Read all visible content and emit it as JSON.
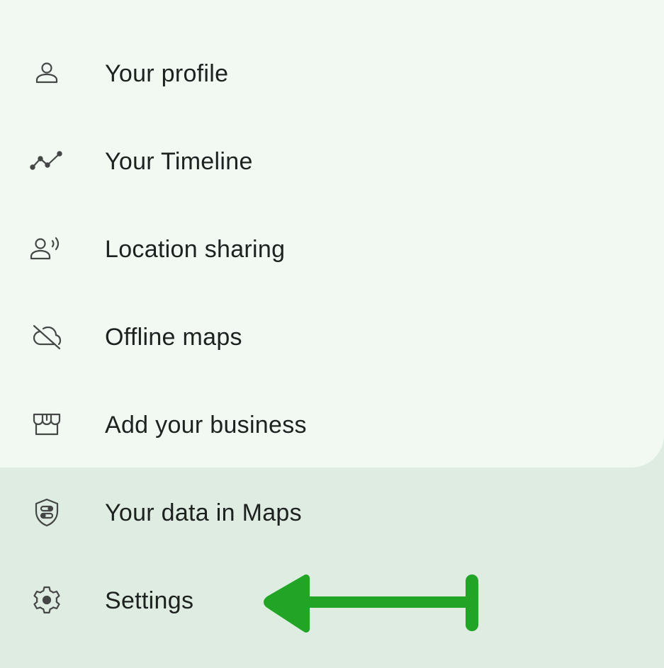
{
  "menu": {
    "items": [
      {
        "label": "Your profile",
        "icon": "person-icon"
      },
      {
        "label": "Your Timeline",
        "icon": "timeline-icon"
      },
      {
        "label": "Location sharing",
        "icon": "location-sharing-icon"
      },
      {
        "label": "Offline maps",
        "icon": "cloud-off-icon"
      },
      {
        "label": "Add your business",
        "icon": "storefront-icon"
      },
      {
        "label": "Your data in Maps",
        "icon": "shield-icon"
      },
      {
        "label": "Settings",
        "icon": "gear-icon"
      }
    ]
  },
  "annotation": {
    "arrow_color": "#22a526",
    "points_to": "Settings"
  },
  "colors": {
    "card_background": "#f2f9f2",
    "page_background": "#dfece2",
    "text": "#1d211f",
    "icon": "#444746"
  }
}
